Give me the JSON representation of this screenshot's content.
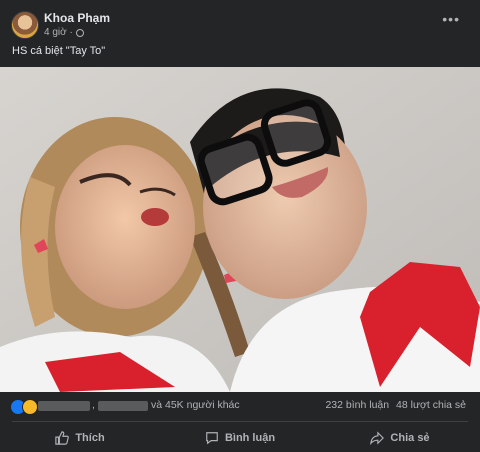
{
  "post": {
    "author": "Khoa Phạm",
    "time": "4 giờ · ",
    "caption": "HS cá biệt \"Tay To\"",
    "more_label": "•••"
  },
  "reactions": {
    "icons": [
      "like-icon",
      "haha-icon"
    ],
    "comma": ",",
    "others_text": "và 45K người khác",
    "comments": "232 bình luận",
    "shares": "48 lượt chia sẻ"
  },
  "actions": {
    "like": "Thích",
    "comment": "Bình luận",
    "share": "Chia sẻ"
  },
  "colors": {
    "background": "#242526",
    "text": "#e4e6eb",
    "muted": "#b0b3b8",
    "like": "#1877f2"
  }
}
